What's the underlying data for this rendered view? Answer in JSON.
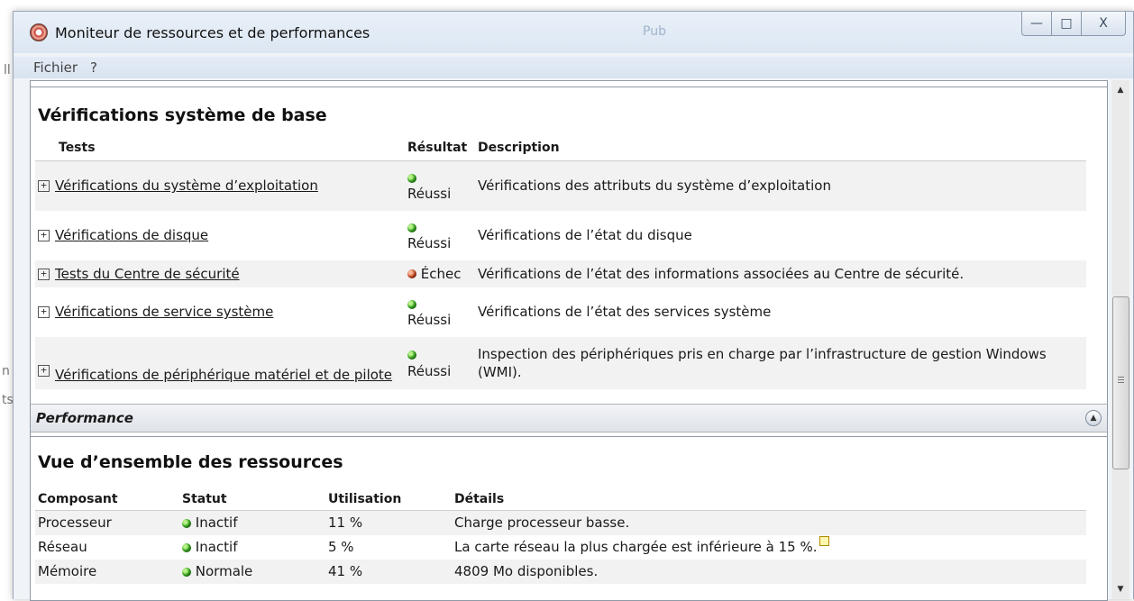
{
  "window": {
    "title": "Moniteur de ressources et de performances",
    "title_hint": "Pub",
    "controls": {
      "minimize": "—",
      "maximize": "□",
      "close": "X"
    }
  },
  "menu": {
    "items": [
      "Fichier",
      "?"
    ]
  },
  "background_fragments": [
    "ll",
    "n",
    "ts"
  ],
  "basic_checks": {
    "title": "Vérifications système de base",
    "columns": [
      "Tests",
      "Résultat",
      "Description"
    ],
    "rows": [
      {
        "test": "Vérifications du système d’exploitation",
        "status": "ok",
        "result": "Réussi",
        "description": "Vérifications des attributs du système d’exploitation"
      },
      {
        "test": "Vérifications de disque",
        "status": "ok",
        "result": "Réussi",
        "description": "Vérifications de l’état du disque"
      },
      {
        "test": "Tests du Centre de sécurité",
        "status": "fail",
        "result": "Échec",
        "description": "Vérifications de l’état des informations associées au Centre de sécurité."
      },
      {
        "test": "Vérifications de service système",
        "status": "ok",
        "result": "Réussi",
        "description": "Vérifications de l’état des services système"
      },
      {
        "test": "Vérifications de périphérique matériel et de pilote",
        "status": "ok",
        "result": "Réussi",
        "description": "Inspection des périphériques pris en charge par l’infrastructure de gestion Windows (WMI)."
      }
    ]
  },
  "performance": {
    "section_title": "Performance"
  },
  "resources": {
    "title": "Vue d’ensemble des ressources",
    "columns": [
      "Composant",
      "Statut",
      "Utilisation",
      "Détails"
    ],
    "rows": [
      {
        "component": "Processeur",
        "status": "Inactif",
        "usage": "11 %",
        "details": "Charge processeur basse."
      },
      {
        "component": "Réseau",
        "status": "Inactif",
        "usage": "5 %",
        "details": "La carte réseau la plus chargée est inférieure à 15 %."
      },
      {
        "component": "Mémoire",
        "status": "Normale",
        "usage": "41 %",
        "details": "4809 Mo disponibles."
      }
    ]
  },
  "colors": {
    "ok": "#46b02a",
    "fail": "#d05a2e",
    "accent": "#dce7f3"
  }
}
